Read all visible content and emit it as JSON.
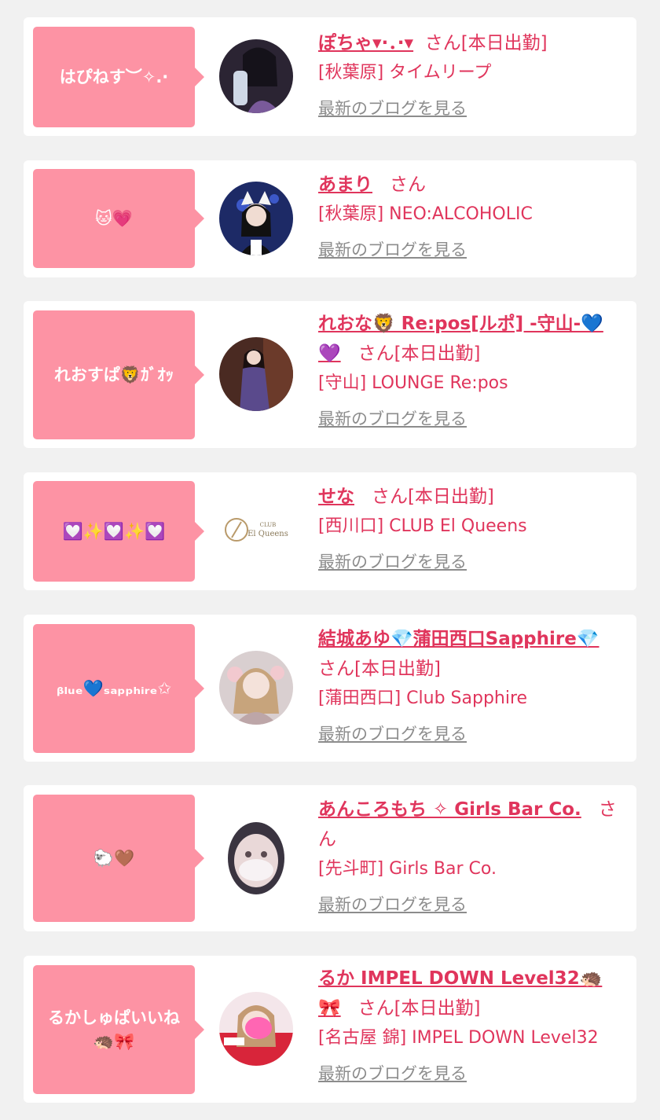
{
  "colors": {
    "page_background": "#f1f1f1",
    "card_background": "#ffffff",
    "bubble": "#fd93a4",
    "accent_text": "#e0355c",
    "link_grey": "#8c8c8c"
  },
  "entries": [
    {
      "bubble_text": "はぴねす︶✧.·",
      "name": "ぽちゃ▾·．·▾",
      "honorific": "さん",
      "attendance": "[本日出勤]",
      "shop": "[秋葉原] タイムリープ",
      "blog_link": "最新のブログを見る",
      "avatar_icon": "cast-photo-avatar"
    },
    {
      "bubble_text": "🐱💗",
      "name": "あまり",
      "honorific": "さん",
      "attendance": "",
      "shop": "[秋葉原] NEO:ALCOHOLIC",
      "blog_link": "最新のブログを見る",
      "avatar_icon": "cast-photo-avatar"
    },
    {
      "bubble_text": "れおすぱ🦁ｶﾞｵｯ",
      "name": "れおな🦁 Re:pos[ルポ] -守山-💙💜",
      "honorific": "さん",
      "attendance": "[本日出勤]",
      "shop": "[守山] LOUNGE Re:pos",
      "blog_link": "最新のブログを見る",
      "avatar_icon": "cast-photo-avatar"
    },
    {
      "bubble_text": "💟✨💟✨💟",
      "name": "せな",
      "honorific": "さん",
      "attendance": "[本日出勤]",
      "shop": "[西川口] CLUB El Queens",
      "blog_link": "最新のブログを見る",
      "avatar_icon": "club-logo-avatar",
      "logo_text_small": "CLUB",
      "logo_text": "El Queens"
    },
    {
      "bubble_text": "ᵦₗᵤₑ💙ₛₐₚₚₕᵢᵣₑ✩",
      "name": "結城あゆ💎蒲田西口Sapphire💎",
      "honorific": "さん",
      "attendance": "[本日出勤]",
      "shop": "[蒲田西口] Club Sapphire",
      "blog_link": "最新のブログを見る",
      "avatar_icon": "cast-photo-avatar"
    },
    {
      "bubble_text": "🐑🤎",
      "name": "あんころもち ✧ Girls Bar Co.",
      "honorific": "さん",
      "attendance": "",
      "shop": "[先斗町] Girls Bar Co.",
      "blog_link": "最新のブログを見る",
      "avatar_icon": "cast-photo-avatar"
    },
    {
      "bubble_text": "るかしゅぱいいね\n🦔🎀",
      "name": "るか IMPEL DOWN Level32🦔🎀",
      "honorific": "さん",
      "attendance": "[本日出勤]",
      "shop": "[名古屋 錦] IMPEL DOWN Level32",
      "blog_link": "最新のブログを見る",
      "avatar_icon": "cast-photo-avatar"
    }
  ]
}
